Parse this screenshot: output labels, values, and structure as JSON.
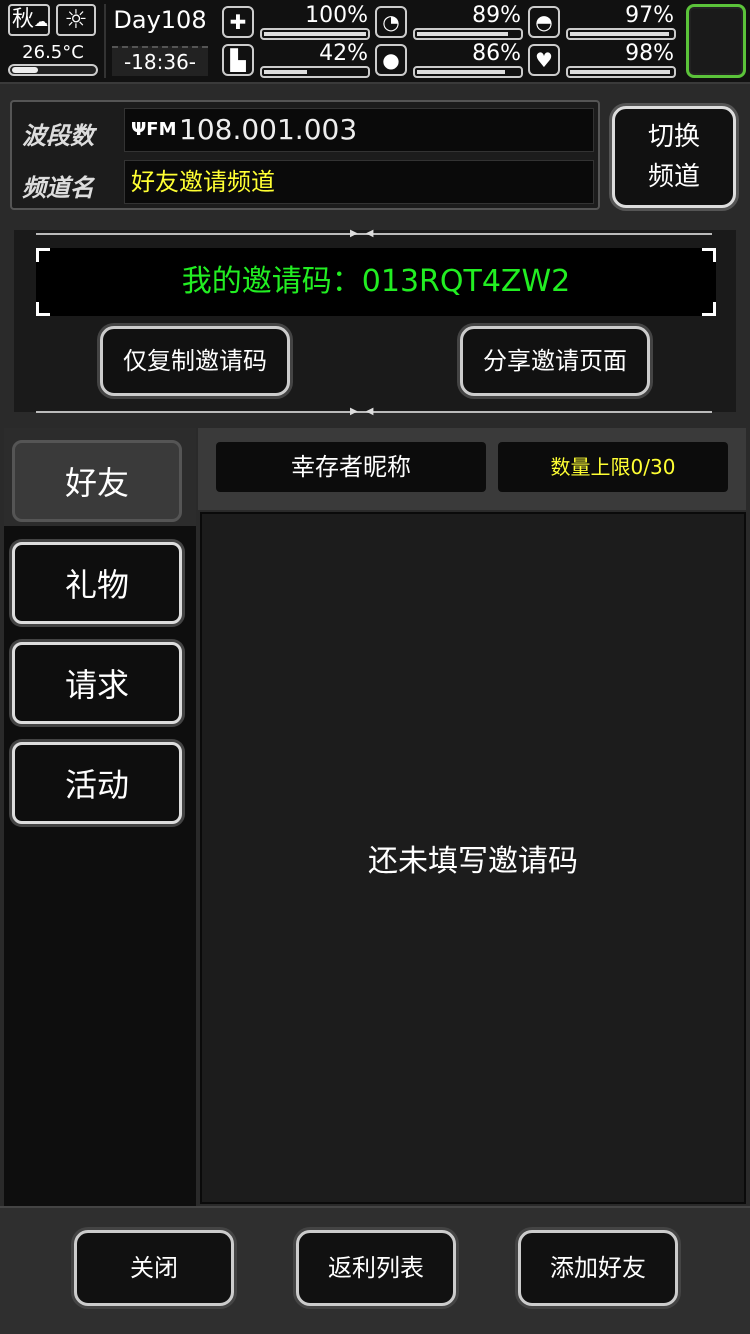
{
  "status": {
    "season": "秋",
    "temperature": "26.5°C",
    "day": "Day108",
    "time": "-18:36-",
    "stats": [
      {
        "icon": "health-kit-icon",
        "glyph": "✚",
        "value": "100%",
        "level": 1.0
      },
      {
        "icon": "stomach-icon",
        "glyph": "◔",
        "value": "89%",
        "level": 0.89
      },
      {
        "icon": "pill-icon",
        "glyph": "◓",
        "value": "97%",
        "level": 0.97
      },
      {
        "icon": "boot-icon",
        "glyph": "▙",
        "value": "42%",
        "level": 0.42
      },
      {
        "icon": "water-drop-icon",
        "glyph": "●",
        "value": "86%",
        "level": 0.86
      },
      {
        "icon": "heart-icon",
        "glyph": "♥",
        "value": "98%",
        "level": 0.98
      }
    ]
  },
  "radio": {
    "band_label": "波段数",
    "band_value": "108.001.003",
    "fm_label": "FM",
    "channel_label": "频道名",
    "channel_value": "好友邀请频道",
    "switch_line1": "切换",
    "switch_line2": "频道"
  },
  "invite": {
    "code_text": "我的邀请码：013RQT4ZW2",
    "copy_button": "仅复制邀请码",
    "share_button": "分享邀请页面"
  },
  "tabs": [
    {
      "label": "好友",
      "active": true
    },
    {
      "label": "礼物",
      "active": false
    },
    {
      "label": "请求",
      "active": false
    },
    {
      "label": "活动",
      "active": false
    }
  ],
  "friends": {
    "column_nickname": "幸存者昵称",
    "column_limit": "数量上限0/30",
    "empty_message": "还未填写邀请码"
  },
  "footer": {
    "close": "关闭",
    "rebate_list": "返利列表",
    "add_friend": "添加好友"
  },
  "colors": {
    "code_green": "#22ee22",
    "channel_yellow": "#ffff33",
    "equip_border": "#5bc33a"
  }
}
